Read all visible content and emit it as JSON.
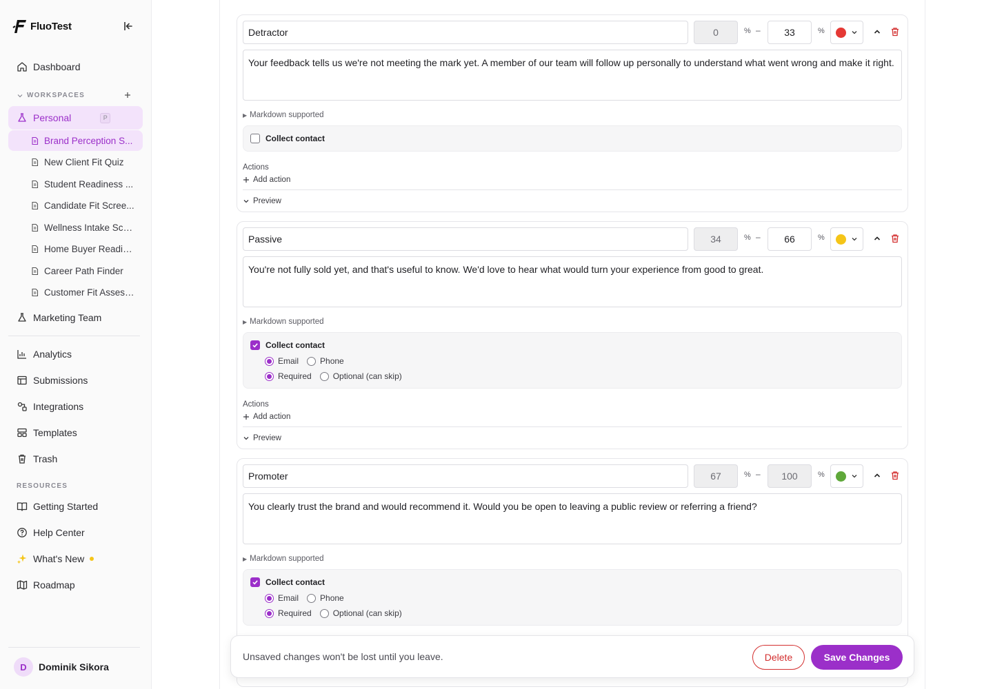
{
  "app": {
    "name": "FluoTest"
  },
  "sidebar": {
    "dashboard": "Dashboard",
    "workspaces_label": "WORKSPACES",
    "personal": {
      "label": "Personal",
      "badge": "P"
    },
    "personal_items": [
      "Brand Perception S...",
      "New Client Fit Quiz",
      "Student Readiness ...",
      "Candidate Fit Scree...",
      "Wellness Intake Scre...",
      "Home Buyer Readin...",
      "Career Path Finder",
      "Customer Fit Assess..."
    ],
    "marketing_team": "Marketing Team",
    "main_nav": [
      "Analytics",
      "Submissions",
      "Integrations",
      "Templates",
      "Trash"
    ],
    "resources_label": "RESOURCES",
    "resources": [
      "Getting Started",
      "Help Center",
      "What's New",
      "Roadmap"
    ],
    "user": {
      "initial": "D",
      "name": "Dominik Sikora"
    }
  },
  "outcomes": [
    {
      "name": "Detractor",
      "min": "0",
      "max": "33",
      "color": "#e53935",
      "message": "Your feedback tells us we're not meeting the mark yet. A member of our team will follow up personally to understand what went wrong and make it right.",
      "collect_contact": false
    },
    {
      "name": "Passive",
      "min": "34",
      "max": "66",
      "color": "#f5c518",
      "message": "You're not fully sold yet, and that's useful to know. We'd love to hear what would turn your experience from good to great.",
      "collect_contact": true
    },
    {
      "name": "Promoter",
      "min": "67",
      "max": "100",
      "color": "#5fa83a",
      "message": "You clearly trust the brand and would recommend it. Would you be open to leaving a public review or referring a friend?",
      "collect_contact": true
    }
  ],
  "labels": {
    "pct": "%",
    "dash": "–",
    "markdown": "Markdown supported",
    "collect_contact": "Collect contact",
    "email": "Email",
    "phone": "Phone",
    "required": "Required",
    "optional": "Optional (can skip)",
    "actions": "Actions",
    "add_action": "Add action",
    "preview": "Preview"
  },
  "save_bar": {
    "message": "Unsaved changes won't be lost until you leave.",
    "delete": "Delete",
    "save": "Save Changes"
  },
  "accent": "#9b2fc9"
}
